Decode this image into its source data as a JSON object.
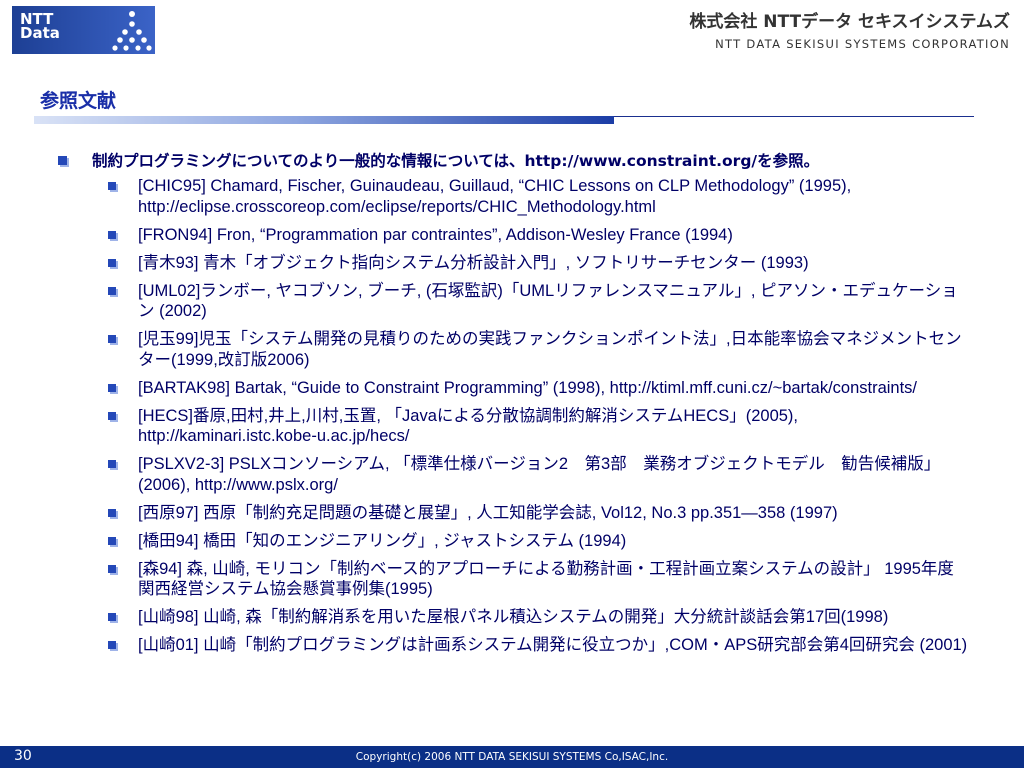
{
  "header": {
    "logo_text": "NTT\nData",
    "company_jp": "株式会社 NTTデータ セキスイシステムズ",
    "company_en": "NTT DATA SEKISUI SYSTEMS CORPORATION"
  },
  "slide": {
    "title": "参照文献",
    "intro": "制約プログラミングについてのより一般的な情報については、http://www.constraint.org/を参照。",
    "references": [
      "[CHIC95] Chamard, Fischer, Guinaudeau, Guillaud, “CHIC Lessons on CLP Methodology” (1995), http://eclipse.crosscoreop.com/eclipse/reports/CHIC_Methodology.html",
      "[FRON94] Fron, “Programmation par contraintes”, Addison-Wesley France (1994)",
      "[青木93] 青木「オブジェクト指向システム分析設計入門」, ソフトリサーチセンター (1993)",
      "[UML02]ランボー, ヤコブソン, ブーチ, (石塚監訳)「UMLリファレンスマニュアル」, ピアソン・エデュケーション (2002)",
      "[児玉99]児玉「システム開発の見積りのための実践ファンクションポイント法」,日本能率協会マネジメントセンター(1999,改訂版2006)",
      "[BARTAK98] Bartak, “Guide to Constraint Programming”  (1998), http://ktiml.mff.cuni.cz/~bartak/constraints/",
      "[HECS]番原,田村,井上,川村,玉置, 「Javaによる分散協調制約解消システムHECS」(2005), http://kaminari.istc.kobe-u.ac.jp/hecs/",
      "[PSLXV2-3] PSLXコンソーシアム, 「標準仕様バージョン2　第3部　業務オブジェクトモデル　勧告候補版」(2006), http://www.pslx.org/",
      "[西原97] 西原「制約充足問題の基礎と展望」, 人工知能学会誌, Vol12, No.3 pp.351—358 (1997)",
      "[橋田94] 橋田「知のエンジニアリング」, ジャストシステム (1994)",
      "[森94] 森, 山崎, モリコン「制約ベース的アプローチによる勤務計画・工程計画立案システムの設計」 1995年度関西経営システム協会懸賞事例集(1995)",
      "[山崎98] 山崎, 森「制約解消系を用いた屋根パネル積込システムの開発」大分統計談話会第17回(1998)",
      "[山崎01] 山崎「制約プログラミングは計画系システム開発に役立つか」,COM・APS研究部会第4回研究会 (2001)"
    ]
  },
  "footer": {
    "page_number": "30",
    "copyright": "Copyright(c) 2006 NTT DATA SEKISUI SYSTEMS Co,ISAC,Inc."
  },
  "colors": {
    "title": "#1a2fa8",
    "text": "#000066",
    "bullet": "#2448b8",
    "footer_bg": "#0b2f86",
    "logo_bg": "#2a4fb0"
  }
}
